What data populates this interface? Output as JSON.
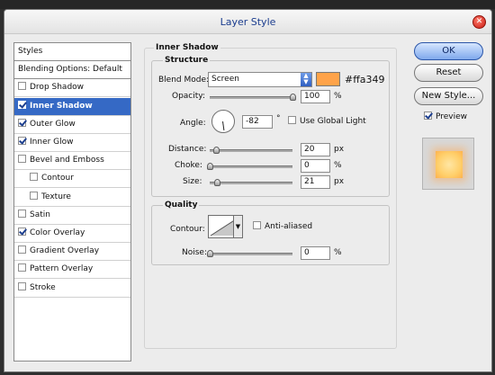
{
  "window": {
    "title": "Layer Style",
    "close_glyph": "✕"
  },
  "styles_list": [
    {
      "label": "Styles",
      "checkbox": false,
      "checked": false,
      "selected": false,
      "sub": false,
      "header": true
    },
    {
      "label": "Blending Options: Default",
      "checkbox": false,
      "checked": false,
      "selected": false,
      "sub": false,
      "header": true
    },
    {
      "label": "Drop Shadow",
      "checkbox": true,
      "checked": false,
      "selected": false,
      "sub": false
    },
    {
      "label": "Inner Shadow",
      "checkbox": true,
      "checked": true,
      "selected": true,
      "sub": false
    },
    {
      "label": "Outer Glow",
      "checkbox": true,
      "checked": true,
      "selected": false,
      "sub": false
    },
    {
      "label": "Inner Glow",
      "checkbox": true,
      "checked": true,
      "selected": false,
      "sub": false
    },
    {
      "label": "Bevel and Emboss",
      "checkbox": true,
      "checked": false,
      "selected": false,
      "sub": false
    },
    {
      "label": "Contour",
      "checkbox": true,
      "checked": false,
      "selected": false,
      "sub": true
    },
    {
      "label": "Texture",
      "checkbox": true,
      "checked": false,
      "selected": false,
      "sub": true
    },
    {
      "label": "Satin",
      "checkbox": true,
      "checked": false,
      "selected": false,
      "sub": false
    },
    {
      "label": "Color Overlay",
      "checkbox": true,
      "checked": true,
      "selected": false,
      "sub": false
    },
    {
      "label": "Gradient Overlay",
      "checkbox": true,
      "checked": false,
      "selected": false,
      "sub": false
    },
    {
      "label": "Pattern Overlay",
      "checkbox": true,
      "checked": false,
      "selected": false,
      "sub": false
    },
    {
      "label": "Stroke",
      "checkbox": true,
      "checked": false,
      "selected": false,
      "sub": false
    }
  ],
  "inner_shadow": {
    "section_title": "Inner Shadow",
    "structure_title": "Structure",
    "blend_mode_label": "Blend Mode:",
    "blend_mode_value": "Screen",
    "color_hex": "#ffa349",
    "color_label": "#ffa349",
    "opacity_label": "Opacity:",
    "opacity_value": "100",
    "opacity_unit": "%",
    "opacity_level": 1.0,
    "angle_label": "Angle:",
    "angle_value": "-82",
    "angle_unit": "°",
    "angle_degrees": -82,
    "use_global_light_label": "Use Global Light",
    "use_global_light": false,
    "distance_label": "Distance:",
    "distance_value": "20",
    "distance_unit": "px",
    "distance_level": 0.08,
    "choke_label": "Choke:",
    "choke_value": "0",
    "choke_unit": "%",
    "choke_level": 0.0,
    "size_label": "Size:",
    "size_value": "21",
    "size_unit": "px",
    "size_level": 0.085
  },
  "quality": {
    "title": "Quality",
    "contour_label": "Contour:",
    "anti_aliased_label": "Anti-aliased",
    "anti_aliased": false,
    "noise_label": "Noise:",
    "noise_value": "0",
    "noise_unit": "%",
    "noise_level": 0.0
  },
  "buttons": {
    "ok": "OK",
    "reset": "Reset",
    "new_style": "New Style...",
    "preview_label": "Preview",
    "preview_checked": true
  },
  "colors": {
    "selection": "#3569c5",
    "preview_glow": "#ffa349"
  }
}
